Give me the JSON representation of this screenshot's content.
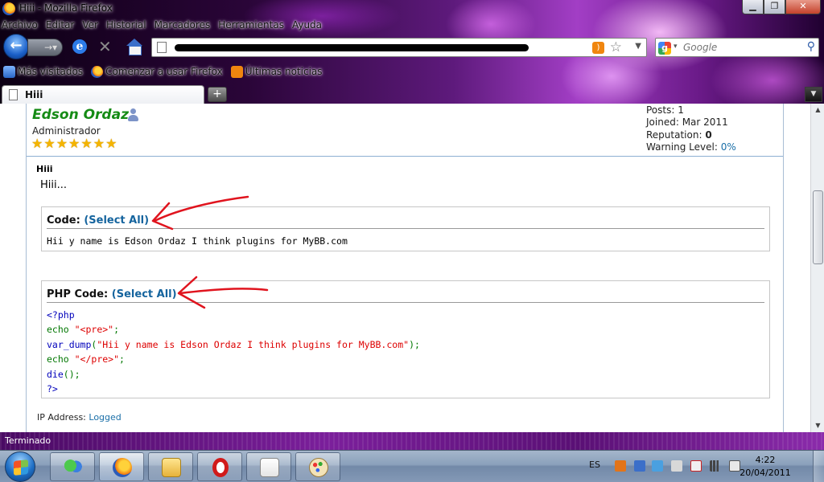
{
  "window": {
    "title": "Hiii - Mozilla Firefox",
    "min_label": "▁",
    "max_label": "❐",
    "close_label": "✕"
  },
  "menu": [
    "Archivo",
    "Editar",
    "Ver",
    "Historial",
    "Marcadores",
    "Herramientas",
    "Ayuda"
  ],
  "search": {
    "placeholder": "Google"
  },
  "bookmarks": [
    "Más visitados",
    "Comenzar a usar Firefox",
    "Últimas noticias"
  ],
  "tab": {
    "label": "Hiii",
    "new_tab_label": "+"
  },
  "post": {
    "author": "Edson Ordaz",
    "role": "Administrador",
    "stars": 7,
    "stats": {
      "posts_label": "Posts:",
      "posts": "1",
      "joined_label": "Joined:",
      "joined": "Mar 2011",
      "reputation_label": "Reputation:",
      "reputation": "0",
      "warning_label": "Warning Level:",
      "warning": "0%"
    },
    "subject": "Hiii",
    "text": "Hiii...",
    "code_block": {
      "label": "Code:",
      "select_all": "(Select All)",
      "content": "Hii y name is Edson Ordaz I think plugins for MyBB.com"
    },
    "php_block": {
      "label": "PHP Code:",
      "select_all": "(Select All)",
      "lines": [
        {
          "parts": [
            {
              "t": "<?php",
              "c": "kw"
            }
          ]
        },
        {
          "parts": [
            {
              "t": "echo ",
              "c": "fn"
            },
            {
              "t": "\"<pre>\"",
              "c": "str"
            },
            {
              "t": ";",
              "c": "fn"
            }
          ]
        },
        {
          "parts": [
            {
              "t": "var_dump",
              "c": "kw"
            },
            {
              "t": "(",
              "c": "fn"
            },
            {
              "t": "\"Hii y name is Edson Ordaz I think plugins for MyBB.com\"",
              "c": "str"
            },
            {
              "t": ");",
              "c": "fn"
            }
          ]
        },
        {
          "parts": [
            {
              "t": "echo ",
              "c": "fn"
            },
            {
              "t": "\"</pre>\"",
              "c": "str"
            },
            {
              "t": ";",
              "c": "fn"
            }
          ]
        },
        {
          "parts": [
            {
              "t": "die",
              "c": "kw"
            },
            {
              "t": "();",
              "c": "fn"
            }
          ]
        },
        {
          "parts": [
            {
              "t": "?>",
              "c": "kw"
            }
          ]
        }
      ]
    },
    "ip_label": "IP Address:",
    "ip_value": "Logged"
  },
  "status": {
    "text": "Terminado"
  },
  "taskbar": {
    "lang": "ES",
    "time": "4:22",
    "date": "20/04/2011"
  },
  "colors": {
    "author_name": "#158b15",
    "link": "#15649e",
    "annotation_arrow": "#e0141e"
  }
}
